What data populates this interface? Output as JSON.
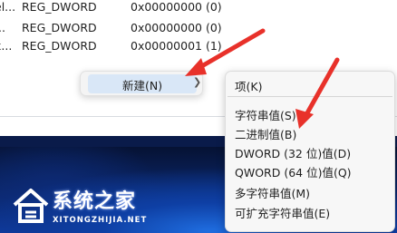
{
  "registry": {
    "rows": [
      {
        "name": "el...",
        "type": "REG_DWORD",
        "data": "0x00000000 (0)"
      },
      {
        "name": "...",
        "type": "REG_DWORD",
        "data": "0x00000000 (0)"
      },
      {
        "name": "x...",
        "type": "REG_DWORD",
        "data": "0x00000001 (1)"
      }
    ]
  },
  "context_menu": {
    "new_label": "新建(N)",
    "chevron_icon": "chevron-right-icon"
  },
  "submenu": {
    "items": [
      {
        "label": "项(K)"
      },
      {
        "label": "字符串值(S)"
      },
      {
        "label": "二进制值(B)"
      },
      {
        "label": "DWORD (32 位)值(D)"
      },
      {
        "label": "QWORD (64 位)值(Q)"
      },
      {
        "label": "多字符串值(M)"
      },
      {
        "label": "可扩充字符串值(E)"
      }
    ]
  },
  "annotations": {
    "arrow_color": "#e8312a"
  },
  "watermark": {
    "title": "系统之家",
    "subtitle": "XITONGZHIJIA.NET",
    "logo_icon": "house-logo-icon"
  },
  "colors": {
    "menu_highlight": "#d9e7f7",
    "menu_bg": "#f4f4f4",
    "wallpaper": "#0e3fa4"
  }
}
